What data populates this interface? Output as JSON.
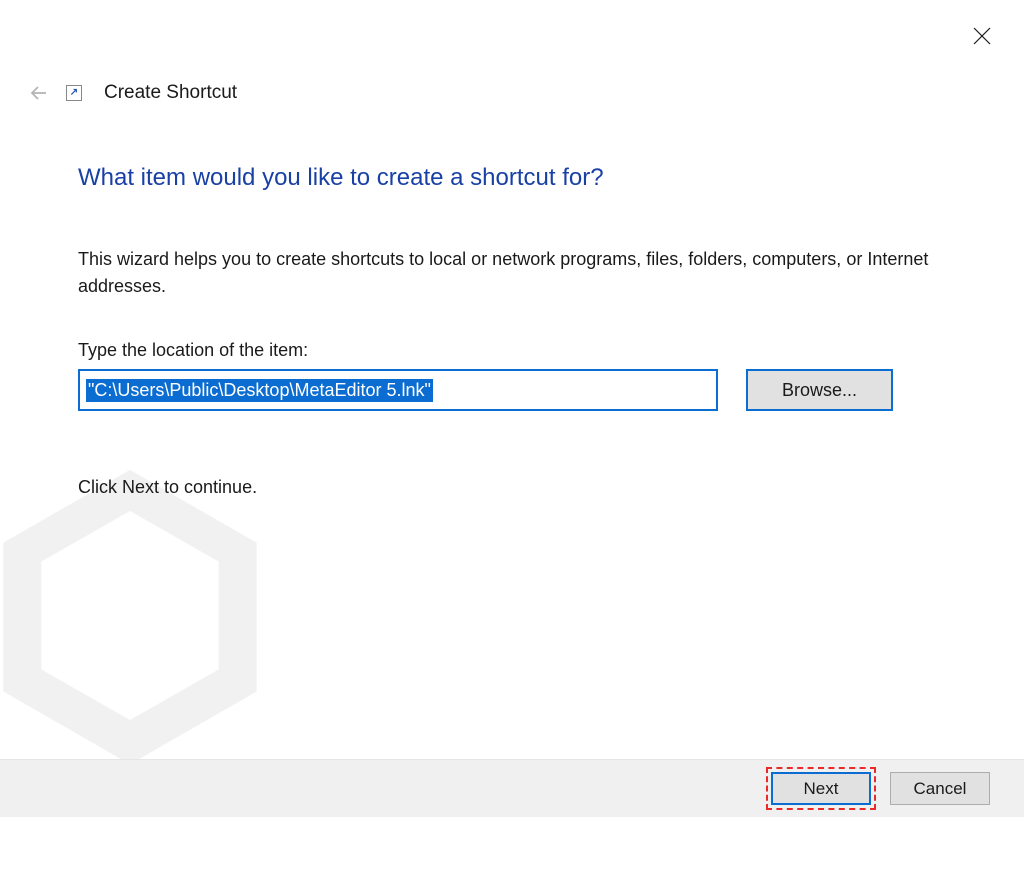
{
  "window": {
    "title": "Create Shortcut"
  },
  "wizard": {
    "heading": "What item would you like to create a shortcut for?",
    "description": "This wizard helps you to create shortcuts to local or network programs, files, folders, computers, or Internet addresses.",
    "field_label": "Type the location of the item:",
    "location_value": "\"C:\\Users\\Public\\Desktop\\MetaEditor 5.lnk\"",
    "browse_label": "Browse...",
    "continue_text": "Click Next to continue."
  },
  "buttons": {
    "next": "Next",
    "cancel": "Cancel"
  }
}
